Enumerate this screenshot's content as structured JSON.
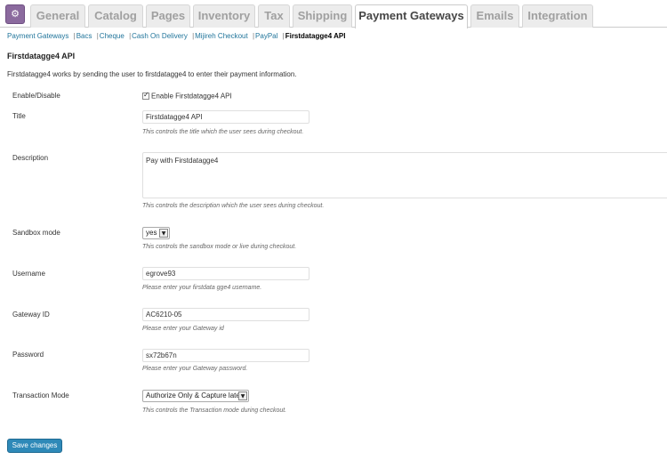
{
  "tabs": [
    {
      "label": "General",
      "active": false
    },
    {
      "label": "Catalog",
      "active": false
    },
    {
      "label": "Pages",
      "active": false
    },
    {
      "label": "Inventory",
      "active": false
    },
    {
      "label": "Tax",
      "active": false
    },
    {
      "label": "Shipping",
      "active": false
    },
    {
      "label": "Payment Gateways",
      "active": true
    },
    {
      "label": "Emails",
      "active": false
    },
    {
      "label": "Integration",
      "active": false
    }
  ],
  "subnav": {
    "items": [
      "Payment Gateways",
      "Bacs",
      "Cheque",
      "Cash On Delivery",
      "Mijireh Checkout",
      "PayPal"
    ],
    "separator": "|",
    "current": "Firstdatagge4 API"
  },
  "section": {
    "title": "Firstdatagge4 API",
    "intro": "Firstdatagge4 works by sending the user to firstdatagge4 to enter their payment information."
  },
  "fields": {
    "enable": {
      "label": "Enable/Disable",
      "checkbox_label": "Enable Firstdatagge4 API",
      "checked": true
    },
    "title": {
      "label": "Title",
      "value": "Firstdatagge4 API",
      "description": "This controls the title which the user sees during checkout."
    },
    "description": {
      "label": "Description",
      "value": "Pay with Firstdatagge4",
      "description": "This controls the description which the user sees during checkout."
    },
    "sandbox": {
      "label": "Sandbox mode",
      "value": "yes",
      "description": "This controls the sandbox mode or live during checkout."
    },
    "username": {
      "label": "Username",
      "value": "egrove93",
      "description": "Please enter your firstdata gge4 username."
    },
    "gateway_id": {
      "label": "Gateway ID",
      "value": "AC6210-05",
      "description": "Please enter your Gateway id"
    },
    "password": {
      "label": "Password",
      "value": "sx72b67n",
      "description": "Please enter your Gateway password."
    },
    "transaction_mode": {
      "label": "Transaction Mode",
      "value": "Authorize Only & Capture later",
      "description": "This controls the Transaction mode during checkout."
    }
  },
  "save_label": "Save changes",
  "colors": {
    "accent": "#21759b",
    "button": "#2e89b8",
    "logo": "#8b6a9e"
  },
  "icons": {
    "logo": "gear-icon",
    "dropdown": "chevron-down-icon",
    "checkbox": "check-icon"
  }
}
